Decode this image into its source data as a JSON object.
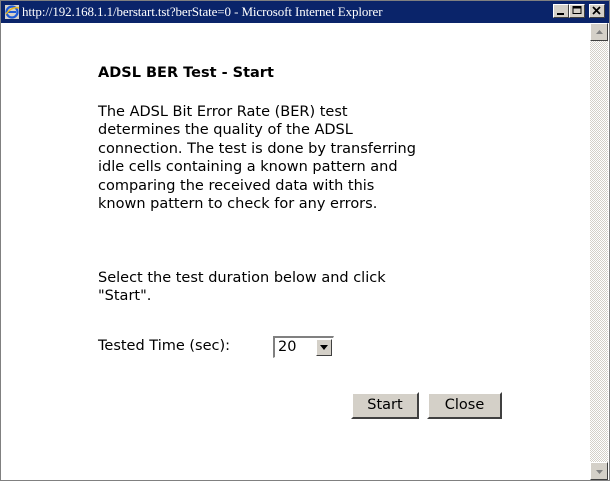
{
  "window": {
    "title": "http://192.168.1.1/berstart.tst?berState=0 - Microsoft Internet Explorer",
    "controls": [
      "minimize",
      "maximize",
      "close"
    ]
  },
  "page": {
    "heading": "ADSL BER Test - Start",
    "description_lines": [
      "The ADSL Bit Error Rate (BER) test",
      "determines the quality of the ADSL",
      "connection. The test is done by transferring",
      "idle cells containing a known pattern and",
      "comparing the received data with this",
      "known pattern to check for any errors."
    ],
    "instruction_lines": [
      "Select the test duration below and click",
      "\"Start\"."
    ],
    "tested_time": {
      "label": "Tested Time (sec):",
      "selected": "20"
    },
    "buttons": {
      "start": "Start",
      "close": "Close"
    }
  },
  "icons": {
    "browser": "ie-icon",
    "minimize": "minimize-icon",
    "maximize": "maximize-icon",
    "close": "close-icon",
    "dropdown": "chevron-down-icon",
    "scroll_up": "scroll-up-arrow-icon",
    "scroll_down": "scroll-down-arrow-icon"
  },
  "colors": {
    "titlebar": "#0a246a",
    "button_face": "#d4d0c8"
  }
}
